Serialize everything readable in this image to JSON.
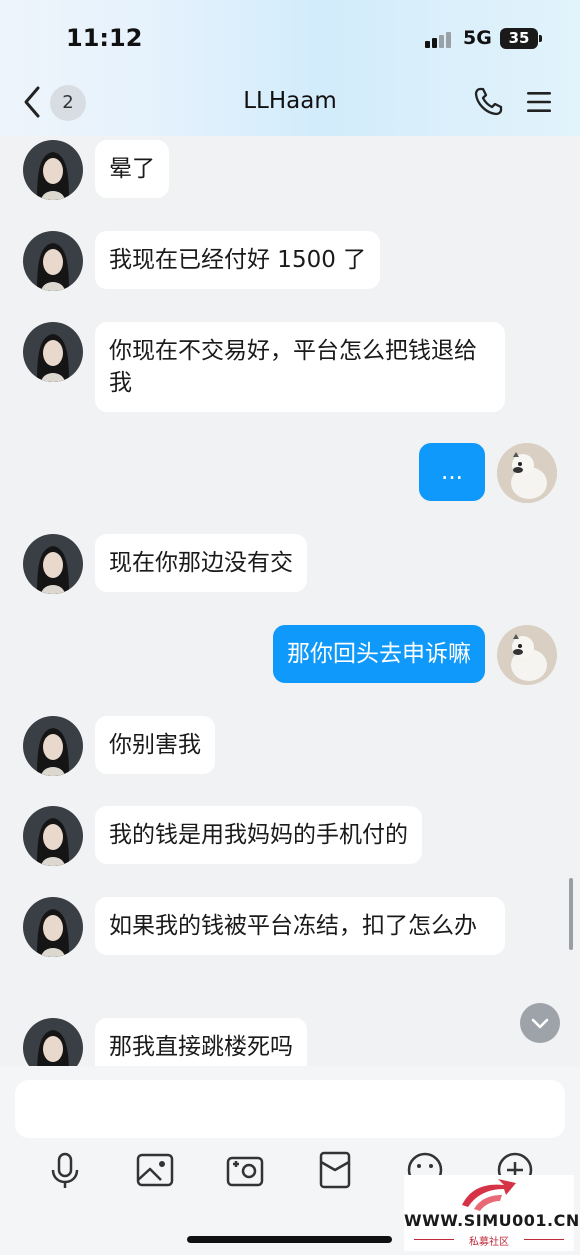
{
  "status_bar": {
    "time": "11:12",
    "network": "5G",
    "battery": "35"
  },
  "header": {
    "unread_count": "2",
    "title": "LLHaam"
  },
  "messages": [
    {
      "side": "in",
      "text": "晕了"
    },
    {
      "side": "in",
      "text": "我现在已经付好 1500 了"
    },
    {
      "side": "in",
      "text": "你现在不交易好，平台怎么把钱退给我"
    },
    {
      "side": "out",
      "text": "..."
    },
    {
      "side": "in",
      "text": "现在你那边没有交"
    },
    {
      "side": "out",
      "text": "那你回头去申诉嘛"
    },
    {
      "side": "in",
      "text": "你别害我"
    },
    {
      "side": "in",
      "text": "我的钱是用我妈妈的手机付的"
    },
    {
      "side": "in",
      "text": "如果我的钱被平台冻结，扣了怎么办"
    },
    {
      "side": "in",
      "text": "那我直接跳楼死吗"
    }
  ],
  "toolbar": {
    "icons": [
      "microphone-icon",
      "image-icon",
      "camera-icon",
      "red-packet-icon",
      "emoji-icon",
      "plus-icon"
    ]
  },
  "watermark": {
    "text": "WWW.SIMU001.CN",
    "subtitle": "私募社区"
  },
  "colors": {
    "outgoing_bubble": "#0f99fb",
    "incoming_bubble": "#ffffff",
    "background": "#f1f2f4"
  }
}
